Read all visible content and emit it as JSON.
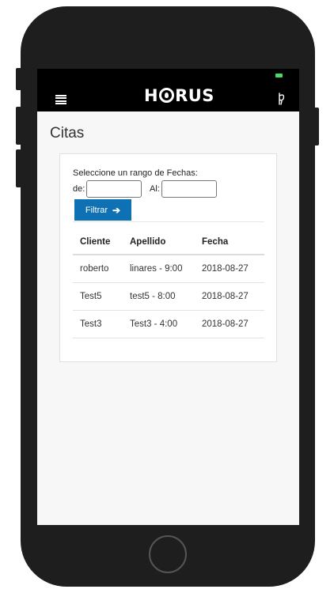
{
  "header": {
    "logo": "HORUS"
  },
  "page": {
    "title": "Citas"
  },
  "filter": {
    "range_label": "Seleccione un rango de Fechas:",
    "from_label": "de:",
    "to_label": "Al:",
    "from_value": "",
    "to_value": "",
    "button_label": "Filtrar",
    "button_icon": "arrow-right-icon",
    "button_color": "#0e71b4"
  },
  "table": {
    "headers": [
      "Cliente",
      "Apellido",
      "Fecha"
    ],
    "rows": [
      [
        "roberto",
        "linares - 9:00",
        "2018-08-27"
      ],
      [
        "Test5",
        "test5 - 8:00",
        "2018-08-27"
      ],
      [
        "Test3",
        "Test3 - 4:00",
        "2018-08-27"
      ]
    ]
  }
}
